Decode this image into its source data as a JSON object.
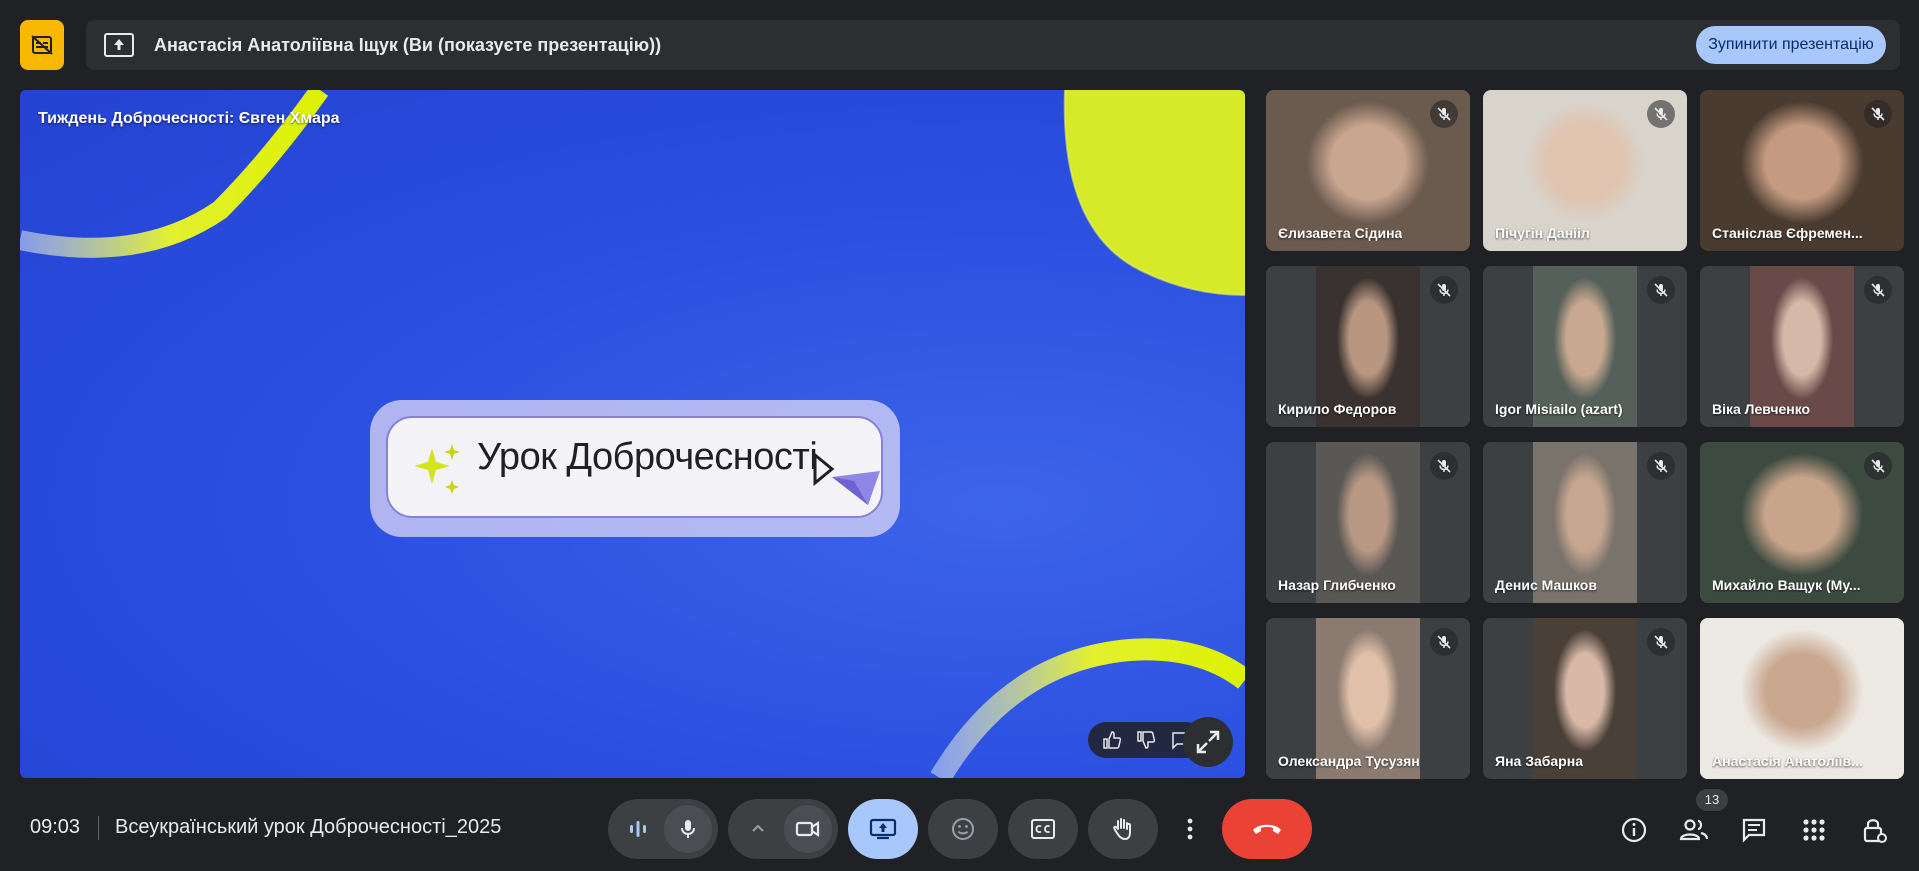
{
  "banner": {
    "presenter_text": "Анастасія Анатоліївна Іщук (Ви (показуєте презентацію))",
    "stop_button_label": "Зупинити презентацію"
  },
  "presentation": {
    "presenter_label": "Тиждень Доброчесності: Євген Хмара",
    "slide_title": "Урок Доброчесності"
  },
  "participants": [
    {
      "name": "Єлизавета Сідина",
      "muted": true
    },
    {
      "name": "Пічугін Данііл",
      "muted": true
    },
    {
      "name": "Станіслав Єфремен...",
      "muted": true
    },
    {
      "name": "Кирило Федоров",
      "muted": true
    },
    {
      "name": "Igor Misiailo (azart)",
      "muted": true
    },
    {
      "name": "Віка Левченко",
      "muted": true
    },
    {
      "name": "Назар Глибченко",
      "muted": true
    },
    {
      "name": "Денис Машков",
      "muted": true
    },
    {
      "name": "Михайло Ващук (Му...",
      "muted": true
    },
    {
      "name": "Олександра Тусузян",
      "muted": true
    },
    {
      "name": "Яна Забарна",
      "muted": true
    },
    {
      "name": "Анастасія Анатоліїв...",
      "muted": false,
      "active": true
    }
  ],
  "bottom_bar": {
    "time": "09:03",
    "meeting_name": "Всеукраїнський урок Доброчесності_2025",
    "people_count": "13"
  },
  "colors": {
    "background": "#202124",
    "accent_blue": "#a8c7fa",
    "end_call_red": "#ea4335",
    "no_subtitles_yellow": "#f9b800"
  },
  "icons": [
    "no-captions-icon",
    "present-icon",
    "mic-icon",
    "camera-icon",
    "emoji-icon",
    "captions-icon",
    "raise-hand-icon",
    "more-vert-icon",
    "end-call-icon",
    "info-icon",
    "people-icon",
    "chat-icon",
    "apps-icon",
    "host-controls-icon"
  ]
}
